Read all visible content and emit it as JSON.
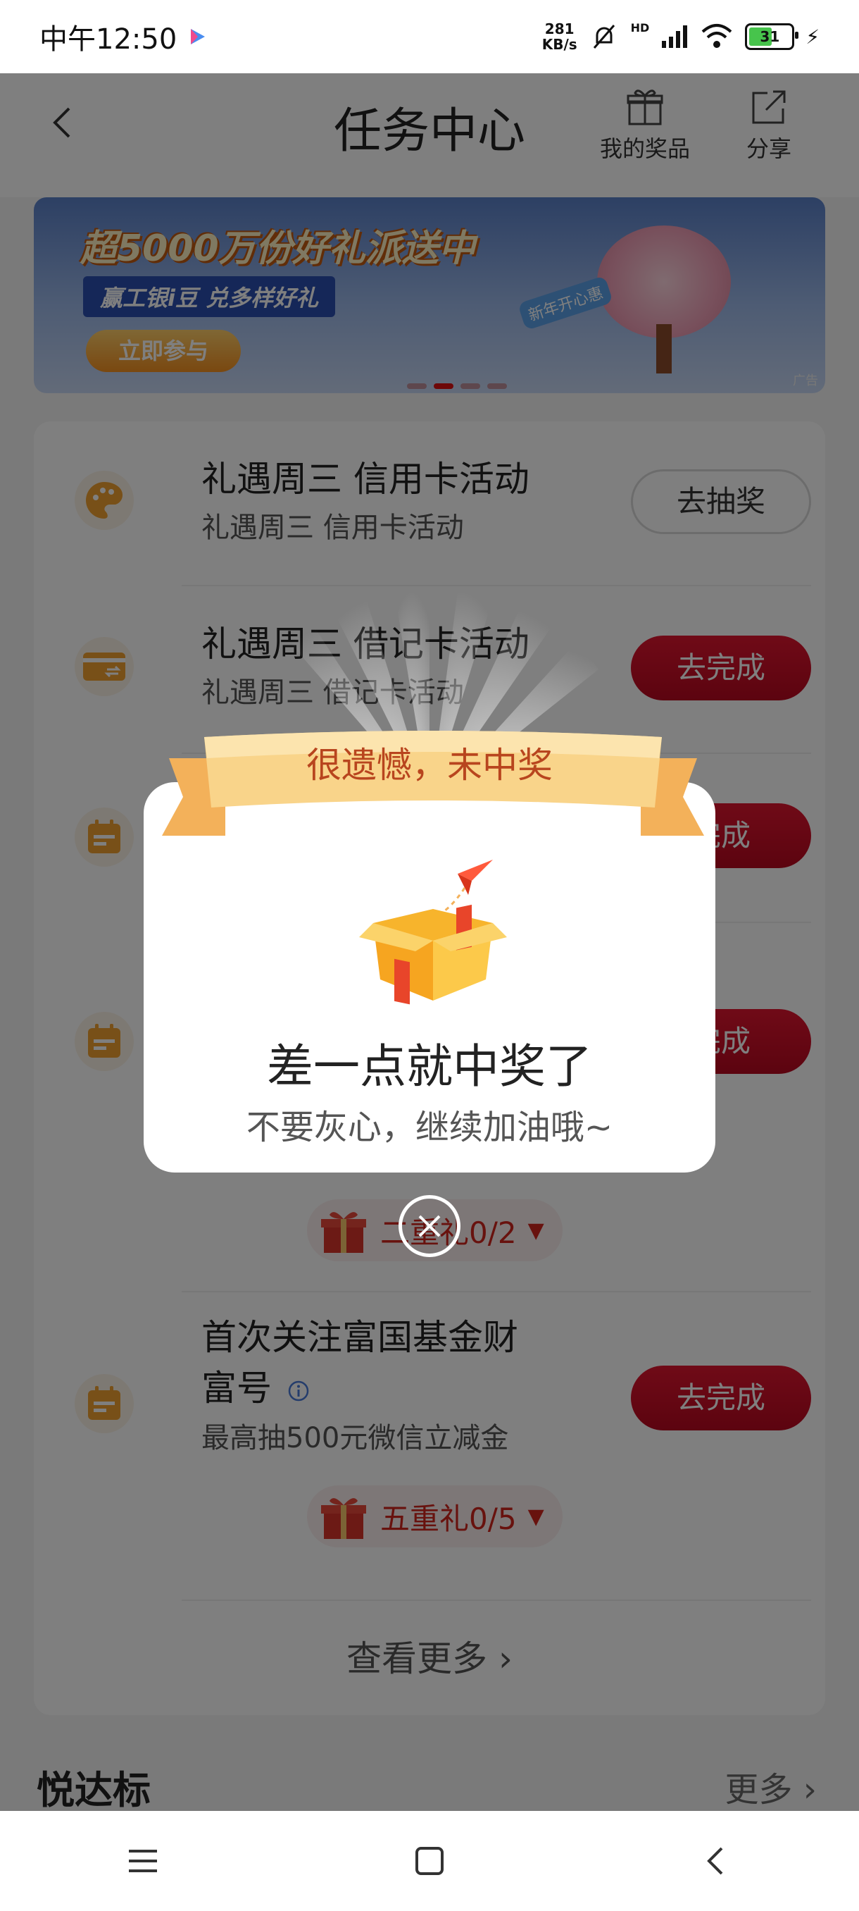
{
  "status_bar": {
    "time": "中午12:50",
    "net_speed_value": "281",
    "net_speed_unit": "KB/s",
    "signal_label": "HD",
    "battery": "31"
  },
  "header": {
    "title": "任务中心",
    "prizes_label": "我的奖品",
    "share_label": "分享"
  },
  "banner": {
    "headline": "超5000万份好礼派送中",
    "subline": "赢工银i豆 兑多样好礼",
    "cta": "立即参与",
    "tag": "新年开心惠",
    "ad_label": "广告"
  },
  "tasks": [
    {
      "title": "礼遇周三 信用卡活动",
      "subtitle": "礼遇周三 信用卡活动",
      "button": "去抽奖"
    },
    {
      "title": "礼遇周三 借记卡活动",
      "subtitle": "礼遇周三 借记卡活动",
      "button": "去完成"
    },
    {
      "button": "完成"
    },
    {
      "button": "完成",
      "gift_label": "二重礼0/2"
    },
    {
      "title_line1": "首次关注富国基金财",
      "title_line2": "富号",
      "subtitle": "最高抽500元微信立减金",
      "button": "去完成",
      "gift_label": "五重礼0/5"
    }
  ],
  "see_more": "查看更多",
  "section": {
    "title": "悦达标",
    "more": "更多"
  },
  "dialog": {
    "ribbon": "很遗憾，未中奖",
    "title": "差一点就中奖了",
    "subtitle": "不要灰心，继续加油哦~"
  },
  "colors": {
    "accent_red": "#c8102e",
    "ribbon": "#f7c66a",
    "icon_orange": "#f0a030"
  }
}
